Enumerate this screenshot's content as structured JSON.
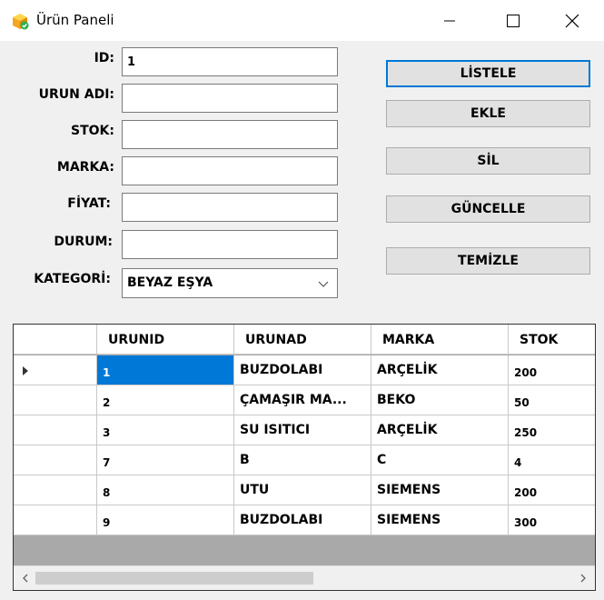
{
  "window": {
    "title": "Ürün Paneli"
  },
  "form": {
    "id_label": "ID:",
    "id_value": "1",
    "urun_adi_label": "URUN ADI:",
    "urun_adi_value": "",
    "stok_label": "STOK:",
    "stok_value": "",
    "marka_label": "MARKA:",
    "marka_value": "",
    "fiyat_label": "FİYAT:",
    "fiyat_value": "",
    "durum_label": "DURUM:",
    "durum_value": "",
    "kategori_label": "KATEGORİ:",
    "kategori_value": "BEYAZ EŞYA"
  },
  "buttons": {
    "listele": "LİSTELE",
    "ekle": "EKLE",
    "sil": "SİL",
    "guncelle": "GÜNCELLE",
    "temizle": "TEMİZLE"
  },
  "grid": {
    "columns": [
      "URUNID",
      "URUNAD",
      "MARKA",
      "STOK"
    ],
    "rows": [
      [
        "1",
        "BUZDOLABI",
        "ARÇELİK",
        "200"
      ],
      [
        "2",
        "ÇAMAŞIR MA...",
        "BEKO",
        "50"
      ],
      [
        "3",
        "SU ISITICI",
        "ARÇELİK",
        "250"
      ],
      [
        "7",
        "B",
        "C",
        "4"
      ],
      [
        "8",
        "UTU",
        "SIEMENS",
        "200"
      ],
      [
        "9",
        "BUZDOLABI",
        "SIEMENS",
        "300"
      ]
    ],
    "current_row_indicator": "current-row-arrow-icon"
  },
  "colors": {
    "accent": "#0078d7",
    "grid_background": "#a9a9a9",
    "button_face": "#e1e1e1"
  },
  "icons": {
    "app": "box-check-icon",
    "minimize": "minimize-icon",
    "maximize": "maximize-icon",
    "close": "close-icon",
    "dropdown": "chevron-down-icon",
    "scroll_left": "scroll-left-icon",
    "scroll_right": "scroll-right-icon"
  }
}
